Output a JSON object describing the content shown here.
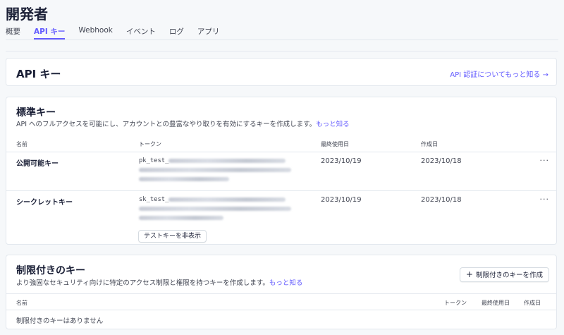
{
  "page": {
    "title": "開発者"
  },
  "tabs": [
    {
      "label": "概要"
    },
    {
      "label": "API キー"
    },
    {
      "label": "Webhook"
    },
    {
      "label": "イベント"
    },
    {
      "label": "ログ"
    },
    {
      "label": "アプリ"
    }
  ],
  "active_tab": "API キー",
  "api_card": {
    "title": "API キー",
    "link": "API 認証についてもっと知る →"
  },
  "standard": {
    "title": "標準キー",
    "description": "API へのフルアクセスを可能にし、アカウントとの豊富なやり取りを有効にするキーを作成します。",
    "more": "もっと知る",
    "columns": {
      "name": "名前",
      "token": "トークン",
      "last_used": "最終使用日",
      "created": "作成日"
    },
    "rows": [
      {
        "name": "公開可能キー",
        "token_prefix": "pk_test_",
        "last_used": "2023/10/19",
        "created": "2023/10/18",
        "menu": "···"
      },
      {
        "name": "シークレットキー",
        "token_prefix": "sk_test_",
        "last_used": "2023/10/19",
        "created": "2023/10/18",
        "menu": "···"
      }
    ],
    "hide_button": "テストキーを非表示"
  },
  "restricted": {
    "title": "制限付きのキー",
    "description": "より強固なセキュリティ向けに特定のアクセス制限と権限を持つキーを作成します。",
    "more": "もっと知る",
    "create_button": "制限付きのキーを作成",
    "create_icon": "+",
    "columns": {
      "name": "名前",
      "token": "トークン",
      "last_used": "最終使用日",
      "created": "作成日"
    },
    "empty": "制限付きのキーはありません"
  },
  "colors": {
    "accent": "#635bff",
    "text": "#1a1f36",
    "muted": "#414552",
    "border": "#e3e8ee",
    "background": "#f6f8fa"
  }
}
